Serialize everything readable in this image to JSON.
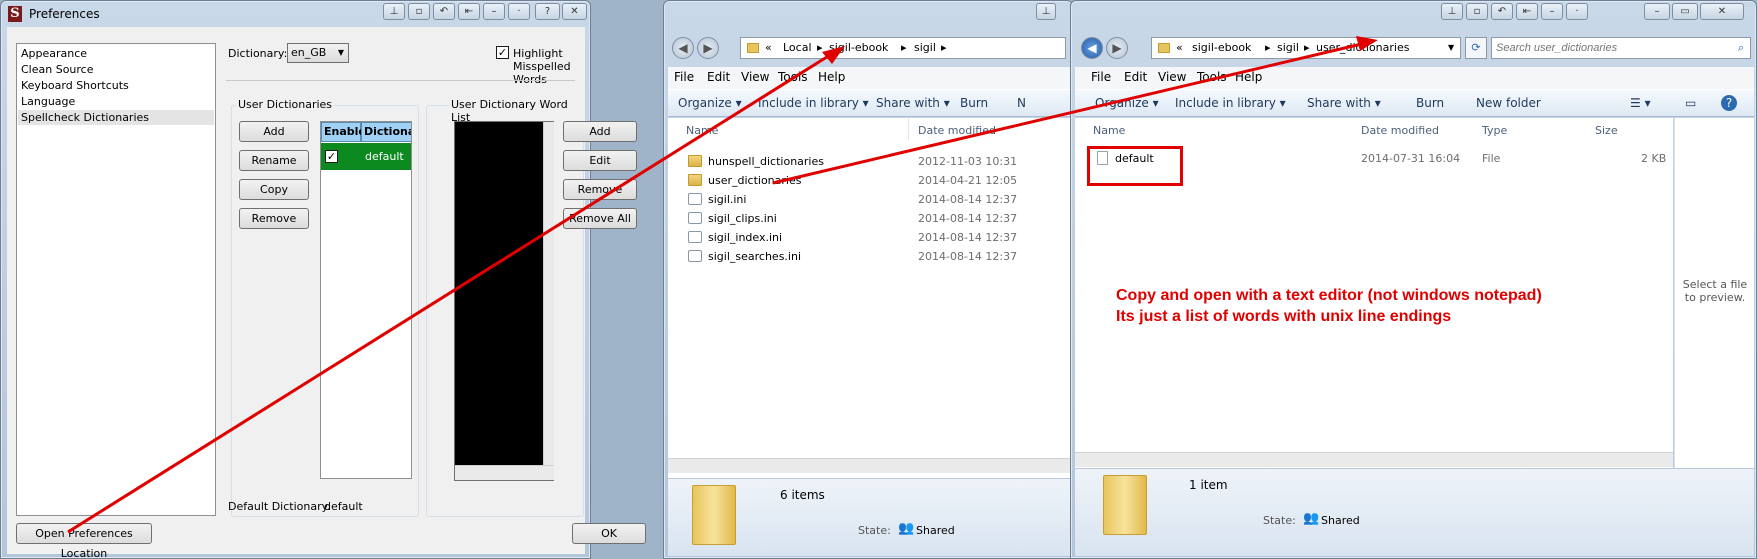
{
  "prefs": {
    "title": "Preferences",
    "caption_buttons": [
      "?",
      "✕"
    ],
    "categories": [
      "Appearance",
      "Clean Source",
      "Keyboard Shortcuts",
      "Language",
      "Spellcheck Dictionaries"
    ],
    "dictionary_label": "Dictionary:",
    "dictionary_value": "en_GB",
    "highlight_label": "Highlight Misspelled Words",
    "highlight_checked": "✓",
    "user_dicts_label": "User Dictionaries",
    "user_dict_buttons": [
      "Add",
      "Rename",
      "Copy",
      "Remove"
    ],
    "table_headers": [
      "Enable",
      "Dictionary"
    ],
    "table_row": {
      "enabled": "✓",
      "name": "default"
    },
    "word_list_label": "User Dictionary Word List",
    "word_buttons": [
      "Add",
      "Edit",
      "Remove",
      "Remove All"
    ],
    "default_dict_label": "Default Dictionary:",
    "default_dict_value": "default",
    "open_location_button": "Open Preferences Location",
    "ok_button": "OK"
  },
  "explorer1": {
    "breadcrumb": [
      "«",
      "Local",
      "sigil-ebook",
      "sigil"
    ],
    "menu": [
      "File",
      "Edit",
      "View",
      "Tools",
      "Help"
    ],
    "toolbar": [
      "Organize ▾",
      "Include in library ▾",
      "Share with ▾",
      "Burn",
      "N"
    ],
    "columns": [
      "Name",
      "Date modified"
    ],
    "files": [
      {
        "name": "hunspell_dictionaries",
        "date": "2012-11-03 10:31",
        "type": "folder"
      },
      {
        "name": "user_dictionaries",
        "date": "2014-04-21 12:05",
        "type": "folder"
      },
      {
        "name": "sigil.ini",
        "date": "2014-08-14 12:37",
        "type": "ini"
      },
      {
        "name": "sigil_clips.ini",
        "date": "2014-08-14 12:37",
        "type": "ini"
      },
      {
        "name": "sigil_index.ini",
        "date": "2014-08-14 12:37",
        "type": "ini"
      },
      {
        "name": "sigil_searches.ini",
        "date": "2014-08-14 12:37",
        "type": "ini"
      }
    ],
    "item_count": "6 items",
    "state_label": "State:",
    "state_value": "Shared"
  },
  "explorer2": {
    "breadcrumb": [
      "«",
      "sigil-ebook",
      "sigil",
      "user_dictionaries"
    ],
    "search_placeholder": "Search user_dictionaries",
    "menu": [
      "File",
      "Edit",
      "View",
      "Tools",
      "Help"
    ],
    "toolbar": [
      "Organize ▾",
      "Include in library ▾",
      "Share with ▾",
      "Burn",
      "New folder"
    ],
    "columns": [
      "Name",
      "Date modified",
      "Type",
      "Size"
    ],
    "file": {
      "name": "default",
      "date": "2014-07-31 16:04",
      "type": "File",
      "size": "2 KB"
    },
    "preview_text": "Select a file to preview.",
    "item_count": "1 item",
    "state_label": "State:",
    "state_value": "Shared"
  },
  "annotation": {
    "line1": "Copy and open with a text editor (not windows notepad)",
    "line2": "Its just a list of words with unix line endings",
    "color": "#e00000"
  }
}
